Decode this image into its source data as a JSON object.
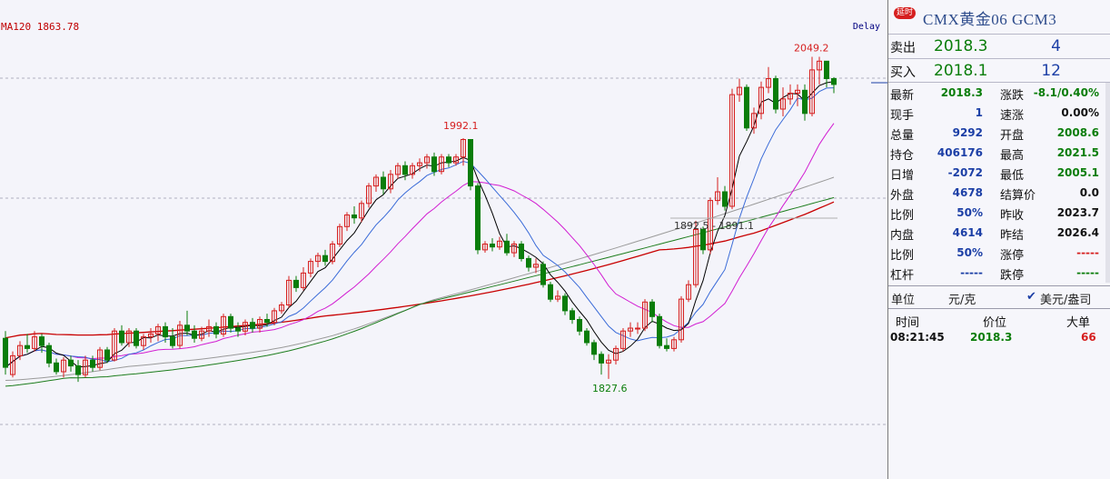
{
  "chart": {
    "ma120_label": "MA120 1863.78",
    "delay_label": "Delay",
    "annotations": {
      "high_main": "2049.2",
      "high_left": "1992.1",
      "low": "1827.6",
      "mid_range": "1892.5 - 1891.1"
    },
    "colors": {
      "up_candle": "#d61f1f",
      "down_candle": "#0a7d0a",
      "ma5": "#000000",
      "ma10": "#3a6bd8",
      "ma20": "#d21ed2",
      "ma60": "#1d7d1d",
      "ma90": "#9a9a9a",
      "ma120": "#c80000"
    }
  },
  "chart_data": {
    "type": "candlestick",
    "title": "",
    "candles": [
      [
        1855,
        1835,
        1860,
        1830
      ],
      [
        1830,
        1843,
        1846,
        1828
      ],
      [
        1843,
        1850,
        1853,
        1840
      ],
      [
        1850,
        1848,
        1858,
        1845
      ],
      [
        1848,
        1856,
        1860,
        1846
      ],
      [
        1856,
        1850,
        1858,
        1845
      ],
      [
        1850,
        1838,
        1852,
        1835
      ],
      [
        1838,
        1832,
        1841,
        1830
      ],
      [
        1832,
        1840,
        1842,
        1828
      ],
      [
        1840,
        1836,
        1843,
        1832
      ],
      [
        1836,
        1830,
        1840,
        1825
      ],
      [
        1830,
        1840,
        1843,
        1828
      ],
      [
        1840,
        1835,
        1843,
        1832
      ],
      [
        1835,
        1847,
        1849,
        1833
      ],
      [
        1847,
        1840,
        1849,
        1838
      ],
      [
        1840,
        1860,
        1862,
        1839
      ],
      [
        1860,
        1852,
        1864,
        1850
      ],
      [
        1852,
        1860,
        1862,
        1849
      ],
      [
        1860,
        1850,
        1862,
        1848
      ],
      [
        1850,
        1856,
        1858,
        1847
      ],
      [
        1856,
        1858,
        1862,
        1852
      ],
      [
        1858,
        1863,
        1865,
        1853
      ],
      [
        1863,
        1856,
        1866,
        1852
      ],
      [
        1856,
        1850,
        1862,
        1848
      ],
      [
        1850,
        1864,
        1867,
        1848
      ],
      [
        1864,
        1860,
        1874,
        1857
      ],
      [
        1860,
        1855,
        1864,
        1852
      ],
      [
        1855,
        1860,
        1863,
        1853
      ],
      [
        1860,
        1863,
        1868,
        1856
      ],
      [
        1863,
        1858,
        1866,
        1855
      ],
      [
        1858,
        1870,
        1872,
        1856
      ],
      [
        1870,
        1862,
        1872,
        1859
      ],
      [
        1862,
        1860,
        1866,
        1856
      ],
      [
        1860,
        1866,
        1868,
        1857
      ],
      [
        1866,
        1862,
        1869,
        1859
      ],
      [
        1862,
        1868,
        1870,
        1859
      ],
      [
        1868,
        1866,
        1872,
        1863
      ],
      [
        1866,
        1874,
        1876,
        1864
      ],
      [
        1874,
        1878,
        1880,
        1872
      ],
      [
        1878,
        1895,
        1898,
        1876
      ],
      [
        1895,
        1890,
        1898,
        1887
      ],
      [
        1890,
        1900,
        1904,
        1888
      ],
      [
        1900,
        1908,
        1910,
        1897
      ],
      [
        1908,
        1912,
        1914,
        1904
      ],
      [
        1912,
        1908,
        1916,
        1905
      ],
      [
        1908,
        1920,
        1922,
        1906
      ],
      [
        1920,
        1932,
        1934,
        1918
      ],
      [
        1932,
        1940,
        1942,
        1929
      ],
      [
        1940,
        1938,
        1946,
        1934
      ],
      [
        1938,
        1948,
        1950,
        1935
      ],
      [
        1948,
        1960,
        1962,
        1945
      ],
      [
        1960,
        1966,
        1968,
        1956
      ],
      [
        1966,
        1958,
        1970,
        1954
      ],
      [
        1958,
        1968,
        1971,
        1955
      ],
      [
        1968,
        1974,
        1976,
        1965
      ],
      [
        1974,
        1968,
        1977,
        1964
      ],
      [
        1968,
        1974,
        1976,
        1965
      ],
      [
        1974,
        1976,
        1979,
        1970
      ],
      [
        1976,
        1980,
        1982,
        1972
      ],
      [
        1980,
        1970,
        1983,
        1967
      ],
      [
        1970,
        1980,
        1982,
        1968
      ],
      [
        1980,
        1976,
        1982,
        1973
      ],
      [
        1976,
        1980,
        1982,
        1974
      ],
      [
        1980,
        1992,
        1993,
        1974
      ],
      [
        1992,
        1960,
        1992,
        1957
      ],
      [
        1960,
        1916,
        1962,
        1913
      ],
      [
        1916,
        1920,
        1922,
        1914
      ],
      [
        1920,
        1918,
        1924,
        1915
      ],
      [
        1918,
        1922,
        1925,
        1916
      ],
      [
        1922,
        1914,
        1927,
        1912
      ],
      [
        1914,
        1920,
        1922,
        1911
      ],
      [
        1920,
        1910,
        1922,
        1908
      ],
      [
        1910,
        1904,
        1912,
        1901
      ],
      [
        1904,
        1906,
        1910,
        1900
      ],
      [
        1906,
        1892,
        1908,
        1890
      ],
      [
        1892,
        1882,
        1894,
        1880
      ],
      [
        1882,
        1884,
        1888,
        1880
      ],
      [
        1884,
        1874,
        1886,
        1871
      ],
      [
        1874,
        1868,
        1876,
        1865
      ],
      [
        1868,
        1860,
        1870,
        1857
      ],
      [
        1860,
        1852,
        1862,
        1850
      ],
      [
        1852,
        1844,
        1854,
        1840
      ],
      [
        1844,
        1838,
        1846,
        1830
      ],
      [
        1838,
        1840,
        1844,
        1827
      ],
      [
        1840,
        1848,
        1850,
        1837
      ],
      [
        1848,
        1860,
        1862,
        1846
      ],
      [
        1860,
        1862,
        1866,
        1856
      ],
      [
        1862,
        1862,
        1866,
        1858
      ],
      [
        1862,
        1880,
        1882,
        1860
      ],
      [
        1880,
        1870,
        1882,
        1866
      ],
      [
        1870,
        1850,
        1872,
        1848
      ],
      [
        1850,
        1848,
        1855,
        1846
      ],
      [
        1848,
        1854,
        1856,
        1846
      ],
      [
        1854,
        1882,
        1884,
        1852
      ],
      [
        1882,
        1892,
        1895,
        1880
      ],
      [
        1892,
        1930,
        1936,
        1890
      ],
      [
        1930,
        1916,
        1932,
        1913
      ],
      [
        1916,
        1950,
        1952,
        1913
      ],
      [
        1950,
        1956,
        1966,
        1947
      ],
      [
        1956,
        1946,
        1960,
        1943
      ],
      [
        1946,
        2023,
        2027,
        1944
      ],
      [
        2023,
        2028,
        2034,
        2018
      ],
      [
        2028,
        2000,
        2030,
        1998
      ],
      [
        2000,
        2010,
        2014,
        1996
      ],
      [
        2010,
        2028,
        2032,
        2006
      ],
      [
        2028,
        2034,
        2042,
        2024
      ],
      [
        2034,
        2013,
        2036,
        2010
      ],
      [
        2013,
        2020,
        2028,
        2008
      ],
      [
        2020,
        2024,
        2030,
        2016
      ],
      [
        2024,
        2026,
        2030,
        2015
      ],
      [
        2026,
        2010,
        2030,
        2005
      ],
      [
        2010,
        2040,
        2049,
        2008
      ],
      [
        2040,
        2046,
        2049,
        2030
      ],
      [
        2046,
        2034,
        2046,
        2028
      ],
      [
        2034,
        2030,
        2035,
        2024
      ]
    ]
  },
  "panel": {
    "badge": "延时",
    "title": "CMX黄金06  GCM3",
    "ask": {
      "label": "卖出",
      "price": "2018.3",
      "volume": "4"
    },
    "bid": {
      "label": "买入",
      "price": "2018.1",
      "volume": "12"
    },
    "rows": [
      {
        "l1": "最新",
        "v1": "2018.3",
        "c1": "green",
        "l2": "涨跌",
        "v2": "-8.1/0.40%",
        "c2": "green"
      },
      {
        "l1": "现手",
        "v1": "1",
        "c1": "blue",
        "l2": "速涨",
        "v2": "0.00%",
        "c2": "black"
      },
      {
        "l1": "总量",
        "v1": "9292",
        "c1": "blue",
        "l2": "开盘",
        "v2": "2008.6",
        "c2": "green"
      },
      {
        "l1": "持仓",
        "v1": "406176",
        "c1": "blue",
        "l2": "最高",
        "v2": "2021.5",
        "c2": "green"
      },
      {
        "l1": "日增",
        "v1": "-2072",
        "c1": "blue",
        "l2": "最低",
        "v2": "2005.1",
        "c2": "green"
      },
      {
        "l1": "外盘",
        "v1": "4678",
        "c1": "blue",
        "l2": "结算价",
        "v2": "0.0",
        "c2": "black"
      },
      {
        "l1": "比例",
        "v1": "50%",
        "c1": "blue",
        "l2": "昨收",
        "v2": "2023.7",
        "c2": "black"
      },
      {
        "l1": "内盘",
        "v1": "4614",
        "c1": "blue",
        "l2": "昨结",
        "v2": "2026.4",
        "c2": "black"
      },
      {
        "l1": "比例",
        "v1": "50%",
        "c1": "blue",
        "l2": "涨停",
        "v2": "-----",
        "c2": "red"
      },
      {
        "l1": "杠杆",
        "v1": "-----",
        "c1": "blue",
        "l2": "跌停",
        "v2": "-----",
        "c2": "green"
      }
    ],
    "unit": {
      "label": "单位",
      "value": "元/克",
      "alt": "美元/盎司",
      "check": "✔"
    },
    "ticks": {
      "headers": {
        "time": "时间",
        "price": "价位",
        "big": "大单"
      },
      "rows": [
        {
          "time": "08:21:45",
          "price": "2018.3",
          "big": "66"
        }
      ]
    }
  }
}
